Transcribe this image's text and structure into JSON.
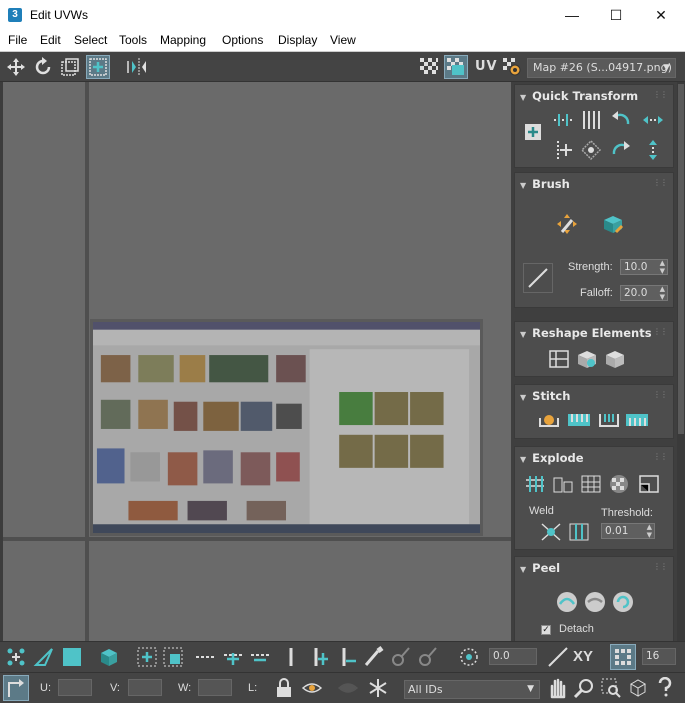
{
  "window": {
    "title": "Edit UVWs",
    "app_icon": "3",
    "minimize": "—",
    "maximize": "☐",
    "close": "✕"
  },
  "menu": [
    "File",
    "Edit",
    "Select",
    "Tools",
    "Mapping",
    "Options",
    "Display",
    "View"
  ],
  "toolbar": {
    "uv_label": "UV",
    "map_select": "Map #26 (S...04917.png)"
  },
  "panel": {
    "quick_transform": {
      "title": "Quick Transform"
    },
    "brush": {
      "title": "Brush",
      "strength_label": "Strength:",
      "strength_value": "10.0",
      "falloff_label": "Falloff:",
      "falloff_value": "20.0"
    },
    "reshape": {
      "title": "Reshape Elements"
    },
    "stitch": {
      "title": "Stitch"
    },
    "explode": {
      "title": "Explode",
      "weld_label": "Weld",
      "threshold_label": "Threshold:",
      "threshold_value": "0.01"
    },
    "peel": {
      "title": "Peel",
      "detach_label": "Detach"
    }
  },
  "bottom": {
    "angle_value": "0.0",
    "xy_label": "XY",
    "grid_value": "16",
    "u_label": "U:",
    "v_label": "V:",
    "w_label": "W:",
    "l_label": "L:",
    "ids_select": "All IDs"
  },
  "colors": {
    "accent": "#4fc3c8",
    "panel": "#4d4d4d",
    "viewport": "#6a6a6a"
  }
}
